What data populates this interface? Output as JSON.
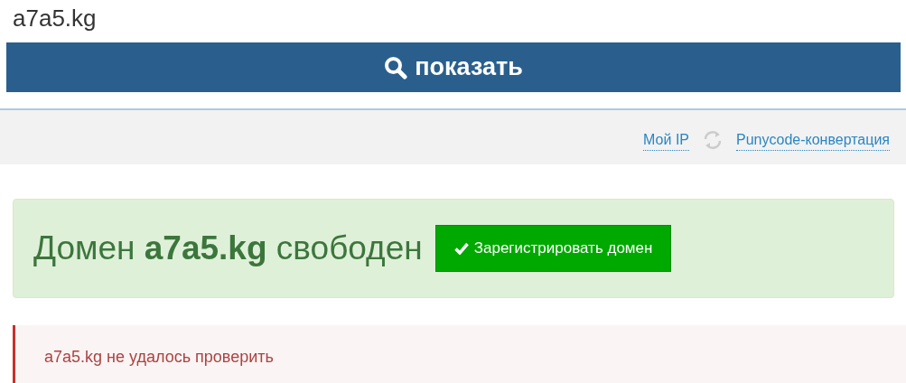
{
  "search": {
    "value": "a7a5.kg",
    "button": "показать"
  },
  "links": [
    {
      "kind": "plain",
      "label": "Мой IP"
    },
    {
      "kind": "refresh",
      "label": "Punycode-конвертация"
    }
  ],
  "result": {
    "headline": "Домен **a7a5.kg** свободен",
    "button": "Зарегистрировать домен"
  },
  "error": {
    "message": "a7a5.kg не удалось проверить"
  }
}
